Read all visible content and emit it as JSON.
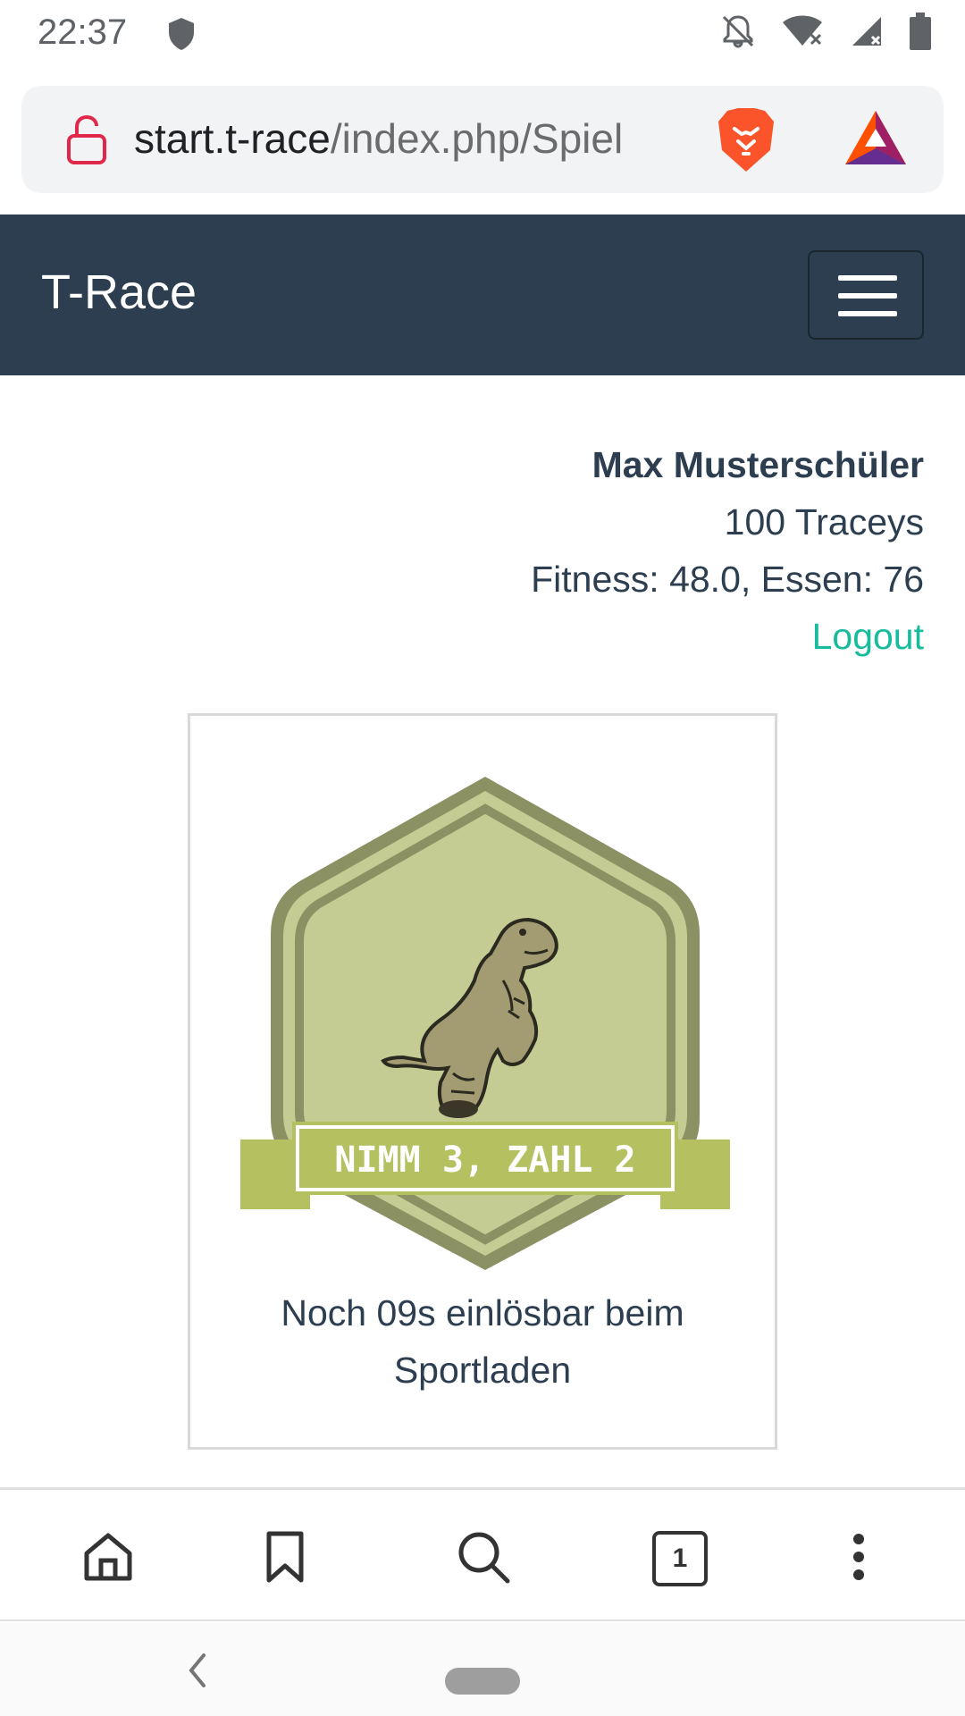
{
  "status_bar": {
    "time": "22:37",
    "icons": [
      "shield-icon",
      "notifications-off-icon",
      "wifi-icon",
      "signal-icon",
      "battery-icon"
    ]
  },
  "browser": {
    "url_host": "start.t-race",
    "url_path": "/index.php/Spiel",
    "icons": [
      "lock-open-icon",
      "brave-lion-icon",
      "bat-rewards-icon"
    ]
  },
  "navbar": {
    "brand": "T-Race",
    "menu_icon": "hamburger-icon"
  },
  "user": {
    "name": "Max Musterschüler",
    "currency": "100 Traceys",
    "stats": "Fitness: 48.0, Essen: 76",
    "logout": "Logout"
  },
  "card": {
    "badge_text": "NIMM 3, ZAHL 2",
    "caption_line1": "Noch 09s einlösbar beim",
    "caption_line2": "Sportladen"
  },
  "bottom_toolbar": {
    "tab_count": "1",
    "icons": [
      "home-icon",
      "bookmark-icon",
      "search-icon",
      "tabs-icon",
      "more-vert-icon"
    ]
  },
  "colors": {
    "navbar": "#2c3e50",
    "accent": "#18bc9c",
    "badge_light": "#c5cc93",
    "badge_dark": "#8b9163",
    "ribbon": "#b5c061"
  }
}
